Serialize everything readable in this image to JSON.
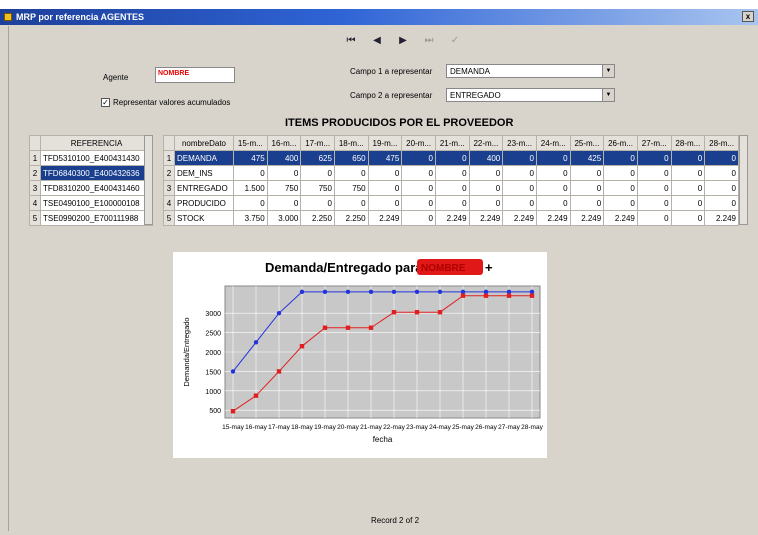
{
  "window": {
    "title": "MRP por referencia AGENTES",
    "close_glyph": "x"
  },
  "nav": {
    "first": "⏮",
    "prev": "◀",
    "next": "▶",
    "last": "⏭",
    "apply": "✓"
  },
  "agent": {
    "label": "Agente",
    "value": "NOMBRE"
  },
  "accumulated": {
    "label": "Representar valores acumulados",
    "checked": true
  },
  "campo1": {
    "label": "Campo 1 a representar",
    "value": "DEMANDA"
  },
  "campo2": {
    "label": "Campo 2 a representar",
    "value": "ENTREGADO"
  },
  "items_title": "ITEMS PRODUCIDOS POR EL PROVEEDOR",
  "ref_table": {
    "header": "REFERENCIA",
    "rows": [
      {
        "n": "1",
        "ref": "TFD5310100_E400431430"
      },
      {
        "n": "2",
        "ref": "TFD6840300_E400432636"
      },
      {
        "n": "3",
        "ref": "TFD8310200_E400431460"
      },
      {
        "n": "4",
        "ref": "TSE0490100_E100000108"
      },
      {
        "n": "5",
        "ref": "TSE0990200_E700111988"
      }
    ],
    "selected": 1
  },
  "data_table": {
    "columns": [
      "nombreDato",
      "15-m...",
      "16-m...",
      "17-m...",
      "18-m...",
      "19-m...",
      "20-m...",
      "21-m...",
      "22-m...",
      "23-m...",
      "24-m...",
      "25-m...",
      "26-m...",
      "27-m...",
      "28-m...",
      "28-m..."
    ],
    "rows": [
      {
        "n": "1",
        "name": "DEMANDA",
        "vals": [
          "475",
          "400",
          "625",
          "650",
          "475",
          "0",
          "0",
          "400",
          "0",
          "0",
          "425",
          "0",
          "0",
          "0",
          "0"
        ]
      },
      {
        "n": "2",
        "name": "DEM_INS",
        "vals": [
          "0",
          "0",
          "0",
          "0",
          "0",
          "0",
          "0",
          "0",
          "0",
          "0",
          "0",
          "0",
          "0",
          "0",
          "0"
        ]
      },
      {
        "n": "3",
        "name": "ENTREGADO",
        "vals": [
          "1.500",
          "750",
          "750",
          "750",
          "0",
          "0",
          "0",
          "0",
          "0",
          "0",
          "0",
          "0",
          "0",
          "0",
          "0"
        ]
      },
      {
        "n": "4",
        "name": "PRODUCIDO",
        "vals": [
          "0",
          "0",
          "0",
          "0",
          "0",
          "0",
          "0",
          "0",
          "0",
          "0",
          "0",
          "0",
          "0",
          "0",
          "0"
        ]
      },
      {
        "n": "5",
        "name": "STOCK",
        "vals": [
          "3.750",
          "3.000",
          "2.250",
          "2.250",
          "2.249",
          "0",
          "2.249",
          "2.249",
          "2.249",
          "2.249",
          "2.249",
          "2.249",
          "0",
          "0",
          "2.249"
        ]
      }
    ],
    "selected": 0
  },
  "chart_data": {
    "type": "line",
    "title": "Demanda/Entregado para",
    "title_suffix": "+",
    "redacted_text": "NOMBRE",
    "xlabel": "fecha",
    "ylabel": "Demanda/Entregado",
    "categories": [
      "15-may",
      "16-may",
      "17-may",
      "18-may",
      "19-may",
      "20-may",
      "21-may",
      "22-may",
      "23-may",
      "24-may",
      "25-may",
      "26-may",
      "27-may",
      "28-may"
    ],
    "series": [
      {
        "values": [
          1500,
          2250,
          3000,
          3550,
          3550,
          3550,
          3550,
          3550,
          3550,
          3550,
          3550,
          3550,
          3550,
          3550
        ],
        "color": "#2233dd"
      },
      {
        "values": [
          475,
          875,
          1500,
          2150,
          2625,
          2625,
          2625,
          3025,
          3025,
          3025,
          3450,
          3450,
          3450,
          3450
        ],
        "color": "#e02020"
      }
    ],
    "yticks": [
      500,
      1000,
      1500,
      2000,
      2500,
      3000
    ],
    "ylim": [
      300,
      3700
    ],
    "grid": true
  },
  "record": "Record 2 of 2"
}
